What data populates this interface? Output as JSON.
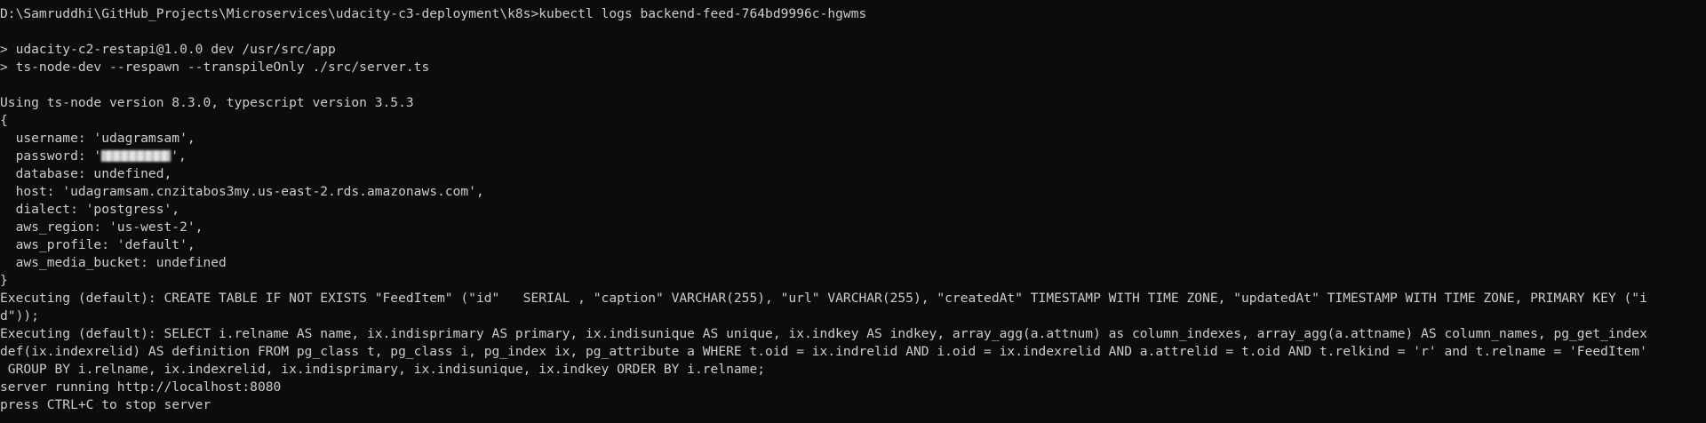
{
  "terminal": {
    "lines": {
      "l0": "D:\\Samruddhi\\GitHub_Projects\\Microservices\\udacity-c3-deployment\\k8s>kubectl logs backend-feed-764bd9996c-hgwms",
      "l1": "",
      "l2": "> udacity-c2-restapi@1.0.0 dev /usr/src/app",
      "l3": "> ts-node-dev --respawn --transpileOnly ./src/server.ts",
      "l4": "",
      "l5": "Using ts-node version 8.3.0, typescript version 3.5.3",
      "l6": "{",
      "l7": "  username: 'udagramsam',",
      "l8_prefix": "  password: '",
      "l8_suffix": "',",
      "l9": "  database: undefined,",
      "l10": "  host: 'udagramsam.cnzitabos3my.us-east-2.rds.amazonaws.com',",
      "l11": "  dialect: 'postgress',",
      "l12": "  aws_region: 'us-west-2',",
      "l13": "  aws_profile: 'default',",
      "l14": "  aws_media_bucket: undefined",
      "l15": "}",
      "l16": "Executing (default): CREATE TABLE IF NOT EXISTS \"FeedItem\" (\"id\"   SERIAL , \"caption\" VARCHAR(255), \"url\" VARCHAR(255), \"createdAt\" TIMESTAMP WITH TIME ZONE, \"updatedAt\" TIMESTAMP WITH TIME ZONE, PRIMARY KEY (\"i",
      "l17": "d\"));",
      "l18": "Executing (default): SELECT i.relname AS name, ix.indisprimary AS primary, ix.indisunique AS unique, ix.indkey AS indkey, array_agg(a.attnum) as column_indexes, array_agg(a.attname) AS column_names, pg_get_index",
      "l19": "def(ix.indexrelid) AS definition FROM pg_class t, pg_class i, pg_index ix, pg_attribute a WHERE t.oid = ix.indrelid AND i.oid = ix.indexrelid AND a.attrelid = t.oid AND t.relkind = 'r' and t.relname = 'FeedItem'",
      "l20": " GROUP BY i.relname, ix.indexrelid, ix.indisprimary, ix.indisunique, ix.indkey ORDER BY i.relname;",
      "l21": "server running http://localhost:8080",
      "l22": "press CTRL+C to stop server"
    }
  },
  "colors": {
    "background": "#0c0c0c",
    "foreground": "#cccccc"
  }
}
